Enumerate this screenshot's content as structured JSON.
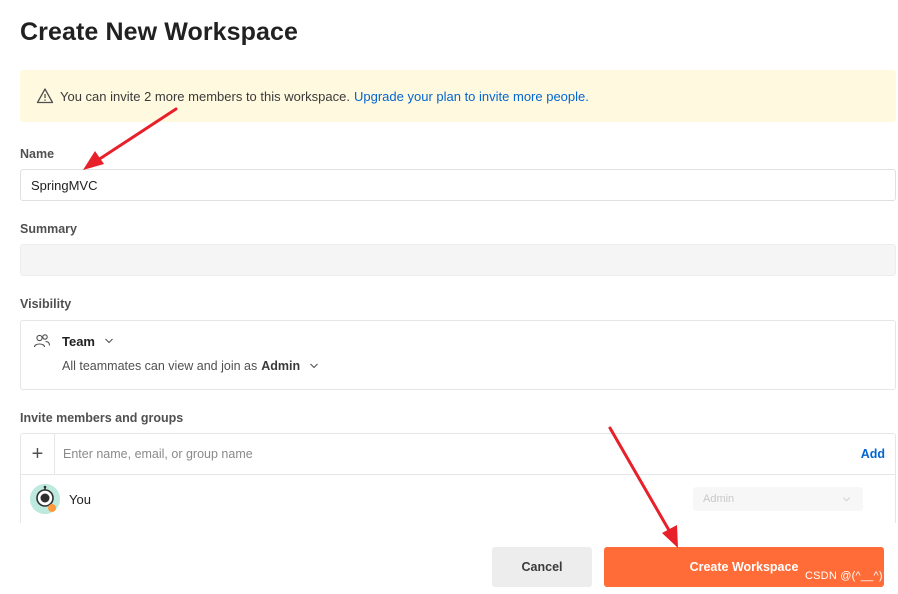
{
  "page": {
    "title": "Create New Workspace"
  },
  "banner": {
    "text": "You can invite 2 more members to this workspace.",
    "link": "Upgrade your plan to invite more people."
  },
  "name": {
    "label": "Name",
    "value": "SpringMVC"
  },
  "summary": {
    "label": "Summary",
    "value": ""
  },
  "visibility": {
    "label": "Visibility",
    "selected": "Team",
    "description": "All teammates can view and join as",
    "role": "Admin"
  },
  "invite": {
    "label": "Invite members and groups",
    "placeholder": "Enter name, email, or group name",
    "add_label": "Add",
    "members": [
      {
        "name": "You",
        "role": "Admin"
      }
    ]
  },
  "actions": {
    "cancel": "Cancel",
    "create": "Create Workspace"
  },
  "watermark": "CSDN @(^__^)",
  "colors": {
    "accent": "#ff6c37",
    "link": "#0265d2",
    "banner_bg": "#fff9e0",
    "annotation_arrow": "#e8202a"
  }
}
